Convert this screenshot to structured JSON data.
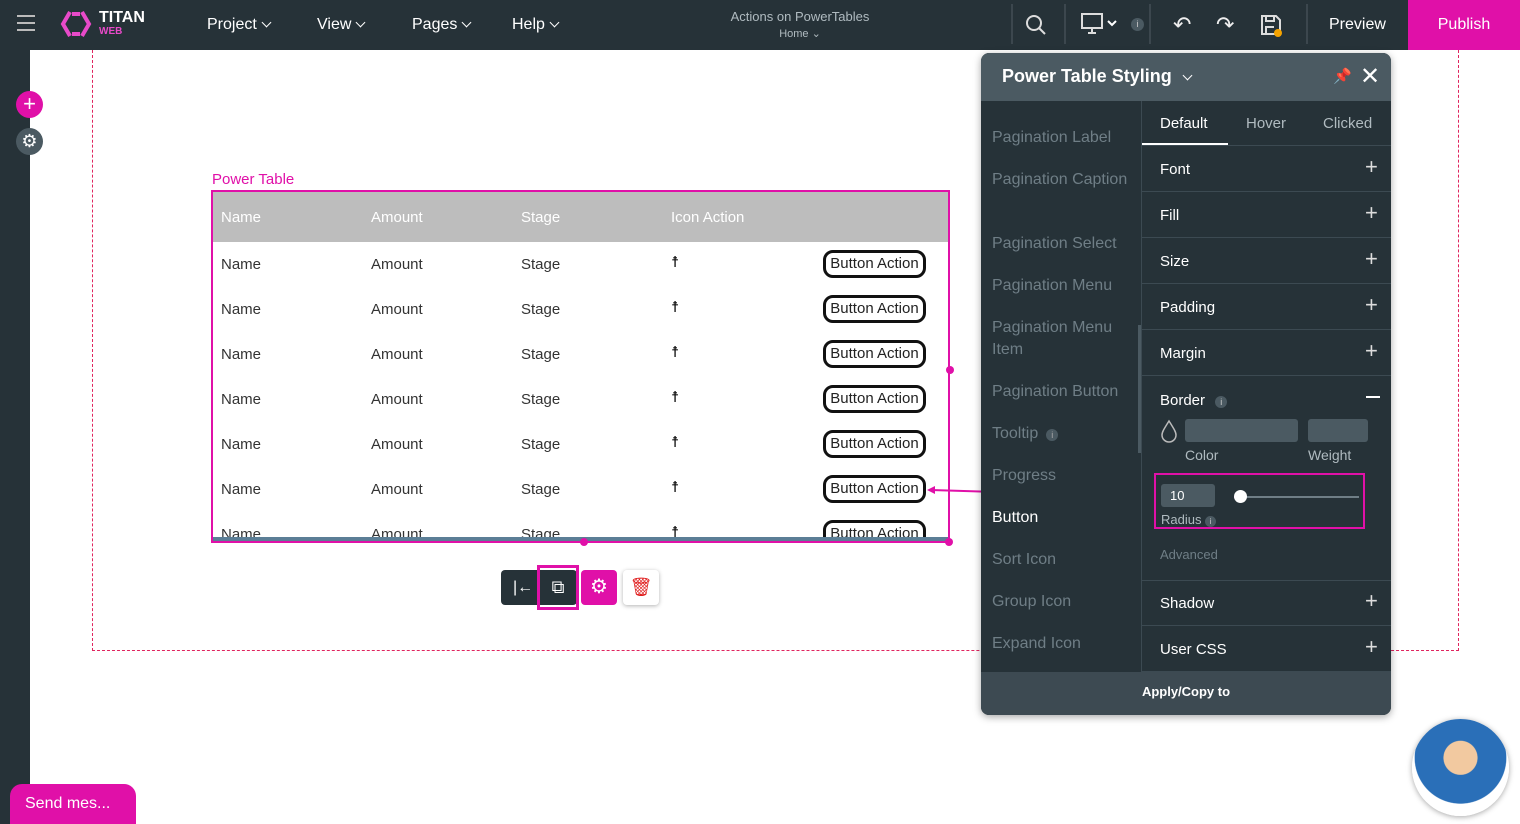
{
  "topbar": {
    "logo_main": "TITAN",
    "logo_sub": "WEB",
    "menus": [
      "Project",
      "View",
      "Pages",
      "Help"
    ],
    "project_title": "Actions on PowerTables",
    "page_name": "Home",
    "preview": "Preview",
    "publish": "Publish"
  },
  "canvas": {
    "component_label": "Power Table",
    "table": {
      "headers": [
        "Name",
        "Amount",
        "Stage",
        "Icon Action"
      ],
      "rows": [
        [
          "Name",
          "Amount",
          "Stage",
          "Button Action"
        ],
        [
          "Name",
          "Amount",
          "Stage",
          "Button Action"
        ],
        [
          "Name",
          "Amount",
          "Stage",
          "Button Action"
        ],
        [
          "Name",
          "Amount",
          "Stage",
          "Button Action"
        ],
        [
          "Name",
          "Amount",
          "Stage",
          "Button Action"
        ],
        [
          "Name",
          "Amount",
          "Stage",
          "Button Action"
        ],
        [
          "Name",
          "Amount",
          "Stage",
          "Button Action"
        ]
      ]
    }
  },
  "panel": {
    "title": "Power Table Styling",
    "elements": [
      {
        "label": "Pagination Label"
      },
      {
        "label": "Pagination Caption"
      },
      {
        "label": "Pagination Select"
      },
      {
        "label": "Pagination Menu"
      },
      {
        "label": "Pagination Menu Item"
      },
      {
        "label": "Pagination Button"
      },
      {
        "label": "Tooltip"
      },
      {
        "label": "Progress"
      },
      {
        "label": "Button",
        "active": true
      },
      {
        "label": "Sort Icon"
      },
      {
        "label": "Group Icon"
      },
      {
        "label": "Expand Icon"
      }
    ],
    "tabs": [
      "Default",
      "Hover",
      "Clicked"
    ],
    "active_tab": "Default",
    "sections": [
      "Font",
      "Fill",
      "Size",
      "Padding",
      "Margin"
    ],
    "border": {
      "title": "Border",
      "color_label": "Color",
      "weight_label": "Weight",
      "radius_value": "10",
      "radius_label": "Radius",
      "radius_slider_percent": 5
    },
    "advanced": "Advanced",
    "sections_after": [
      "Shadow",
      "User CSS"
    ],
    "apply": "Apply/Copy to"
  },
  "chat": {
    "label": "Send mes..."
  },
  "colors": {
    "accent": "#e010a8",
    "topbar": "#263238"
  }
}
